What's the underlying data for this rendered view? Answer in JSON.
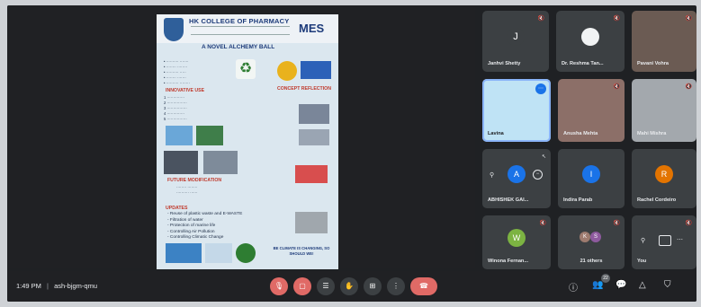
{
  "meeting": {
    "time": "1:49 PM",
    "code": "ash-bjgm-qmu"
  },
  "poster": {
    "college": "HK COLLEGE OF PHARMACY",
    "mes": "MES",
    "project_title": "A NOVEL ALCHEMY BALL",
    "sections": {
      "innovative": "INNOVATIVE USE",
      "future": "FUTURE MODIFICATION",
      "updates": "UPDATES",
      "conc": "CONCEPT REFLECTION"
    },
    "update_lines": "- Reuse of plastic waste and E-WASTE\n- Filtration of water\n- Protection of marine life\n- Controlling Air Pollution\n- Controlling Climatic Change",
    "footer": "BE CLIMATE IS CHANGING, SO SHOULD WE!"
  },
  "participants": [
    {
      "name": "Janhvi Shetty",
      "initial": "J",
      "avatar_color": "#3c4043"
    },
    {
      "name": "Dr. Reshma Tan...",
      "initial": "",
      "avatar_color": "#f1f3f4"
    },
    {
      "name": "Pavani Vohra",
      "initial": "",
      "avatar_color": "#6b5b53"
    },
    {
      "name": "Lavina",
      "initial": "",
      "avatar_color": "#bfe3f5"
    },
    {
      "name": "Anusha Mehta",
      "initial": "",
      "avatar_color": "#8c6f68"
    },
    {
      "name": "Mahi Mishra",
      "initial": "",
      "avatar_color": "#a3a8ad"
    },
    {
      "name": "ABHISHEK GAI...",
      "initial": "A",
      "avatar_color": "#1a73e8"
    },
    {
      "name": "Indira Parab",
      "initial": "I",
      "avatar_color": "#1a73e8"
    },
    {
      "name": "Rachel Cordeiro",
      "initial": "R",
      "avatar_color": "#e37400"
    },
    {
      "name": "Winona Fernan...",
      "initial": "W",
      "avatar_color": "#7cb342"
    },
    {
      "name": "21 others",
      "initial": "",
      "avatar_color": "#3c4043"
    },
    {
      "name": "You",
      "initial": "",
      "avatar_color": "#3c4043"
    }
  ],
  "controls": {
    "others_avatars": [
      "K",
      "S"
    ],
    "people_count": "22"
  },
  "icons": {
    "mic_off": "mic-off-icon",
    "camera_off": "camera-off-icon",
    "captions": "captions-icon",
    "raise_hand": "hand-icon",
    "present": "present-icon",
    "more": "more-icon",
    "end_call": "end-call-icon",
    "info": "info-icon",
    "people": "people-icon",
    "chat": "chat-icon",
    "activities": "activities-icon",
    "host_controls": "shield-icon"
  }
}
